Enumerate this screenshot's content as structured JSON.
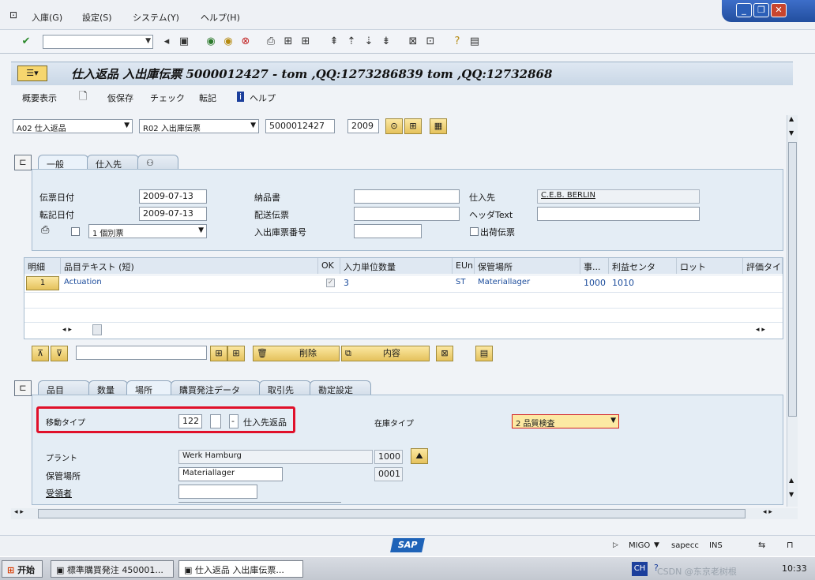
{
  "menu": [
    "入庫(G)",
    "設定(S)",
    "システム(Y)",
    "ヘルプ(H)"
  ],
  "title": "仕入返品 入出庫伝票 5000012427 - tom ,QQ:1273286839 tom ,QQ:12732868",
  "app_toolbar": {
    "overview": "概要表示",
    "hold": "仮保存",
    "check": "チェック",
    "post": "転記",
    "help": "ヘルプ"
  },
  "header": {
    "action": "A02 仕入返品",
    "ref_doc": "R02 入出庫伝票",
    "doc_number": "5000012427",
    "year": "2009"
  },
  "header_tabs": [
    "一般",
    "仕入先"
  ],
  "general": {
    "doc_date_label": "伝票日付",
    "doc_date": "2009-07-13",
    "post_date_label": "転記日付",
    "post_date": "2009-07-13",
    "print_option": "1 個別票",
    "delivery_note_label": "納品書",
    "delivery_note": "",
    "bill_of_lading_label": "配送伝票",
    "bill_of_lading": "",
    "gr_slip_label": "入出庫票番号",
    "gr_slip": "",
    "vendor_label": "仕入先",
    "vendor": "C.E.B. BERLIN",
    "header_text_label": "ヘッダText",
    "header_text": "",
    "delivery_slip_label": "出荷伝票"
  },
  "grid": {
    "columns": [
      "明細",
      "品目テキスト (短)",
      "OK",
      "入力単位数量",
      "EUn",
      "保管場所",
      "事...",
      "利益センタ",
      "ロット",
      "評価タイ"
    ],
    "rows": [
      {
        "line": "1",
        "text": "Actuation",
        "qty": "3",
        "uom": "ST",
        "sloc": "Materiallager",
        "plant": "1000",
        "profit": "1010"
      }
    ]
  },
  "grid_buttons": {
    "delete": "削除",
    "contents": "内容"
  },
  "detail_tabs": [
    "品目",
    "数量",
    "場所",
    "購買発注データ",
    "取引先",
    "勘定設定"
  ],
  "detail": {
    "mvt_label": "移動タイプ",
    "mvt": "122",
    "mvt_sign": "-",
    "mvt_text": "仕入先返品",
    "stock_type_label": "在庫タイプ",
    "stock_type": "2 品質検査",
    "plant_label": "プラント",
    "plant_name": "Werk Hamburg",
    "plant": "1000",
    "sloc_label": "保管場所",
    "sloc_name": "Materiallager",
    "sloc": "0001",
    "recipient_label": "受領者"
  },
  "status": {
    "tcode": "MIGO",
    "server": "sapecc",
    "mode": "INS"
  },
  "taskbar": {
    "start": "开始",
    "task1": "標準購買発注 450001...",
    "task2": "仕入返品 入出庫伝票...",
    "lang": "CH",
    "clock": "10:33"
  },
  "watermark": "CSDN @东京老树根"
}
